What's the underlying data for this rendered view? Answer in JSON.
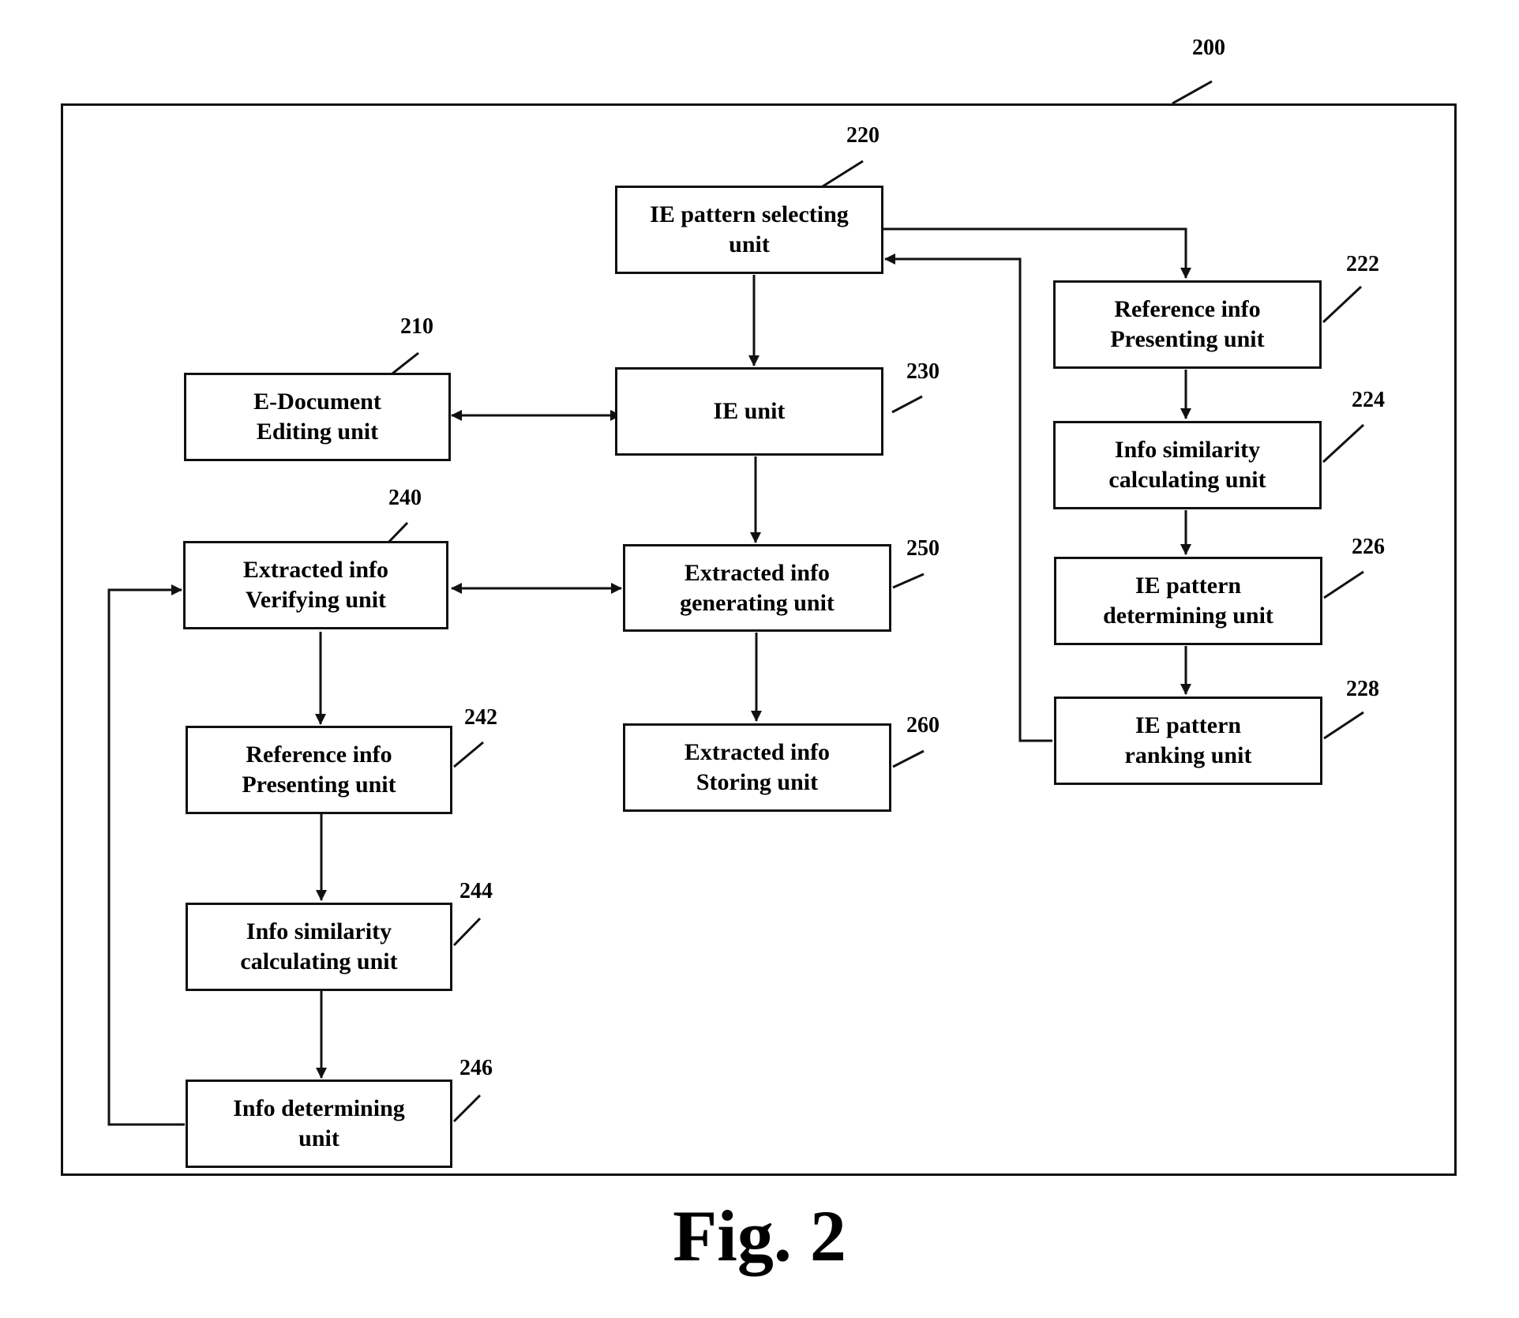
{
  "figure": {
    "caption": "Fig. 2",
    "system_ref": "200"
  },
  "units": [
    {
      "id": "u210",
      "ref": "210",
      "label": "E-Document\nEditing unit"
    },
    {
      "id": "u220",
      "ref": "220",
      "label": "IE pattern selecting\nunit"
    },
    {
      "id": "u222",
      "ref": "222",
      "label": "Reference info\nPresenting unit"
    },
    {
      "id": "u224",
      "ref": "224",
      "label": "Info similarity\ncalculating unit"
    },
    {
      "id": "u226",
      "ref": "226",
      "label": "IE pattern\ndetermining unit"
    },
    {
      "id": "u228",
      "ref": "228",
      "label": "IE pattern\nranking unit"
    },
    {
      "id": "u230",
      "ref": "230",
      "label": "IE unit"
    },
    {
      "id": "u240",
      "ref": "240",
      "label": "Extracted info\nVerifying unit"
    },
    {
      "id": "u242",
      "ref": "242",
      "label": "Reference info\nPresenting unit"
    },
    {
      "id": "u244",
      "ref": "244",
      "label": "Info similarity\ncalculating unit"
    },
    {
      "id": "u246",
      "ref": "246",
      "label": "Info determining\nunit"
    },
    {
      "id": "u250",
      "ref": "250",
      "label": "Extracted info\ngenerating unit"
    },
    {
      "id": "u260",
      "ref": "260",
      "label": "Extracted info\nStoring unit"
    }
  ],
  "connections": [
    {
      "from": "220",
      "to": "230",
      "type": "one-way"
    },
    {
      "from": "220",
      "to": "222",
      "type": "one-way"
    },
    {
      "from": "222",
      "to": "224",
      "type": "one-way"
    },
    {
      "from": "224",
      "to": "226",
      "type": "one-way"
    },
    {
      "from": "226",
      "to": "228",
      "type": "one-way"
    },
    {
      "from": "228",
      "to": "220",
      "type": "one-way"
    },
    {
      "from": "210",
      "to": "230",
      "type": "two-way"
    },
    {
      "from": "230",
      "to": "250",
      "type": "one-way"
    },
    {
      "from": "240",
      "to": "250",
      "type": "two-way"
    },
    {
      "from": "250",
      "to": "260",
      "type": "one-way"
    },
    {
      "from": "240",
      "to": "242",
      "type": "one-way"
    },
    {
      "from": "242",
      "to": "244",
      "type": "one-way"
    },
    {
      "from": "244",
      "to": "246",
      "type": "one-way"
    },
    {
      "from": "246",
      "to": "240",
      "type": "one-way"
    }
  ]
}
